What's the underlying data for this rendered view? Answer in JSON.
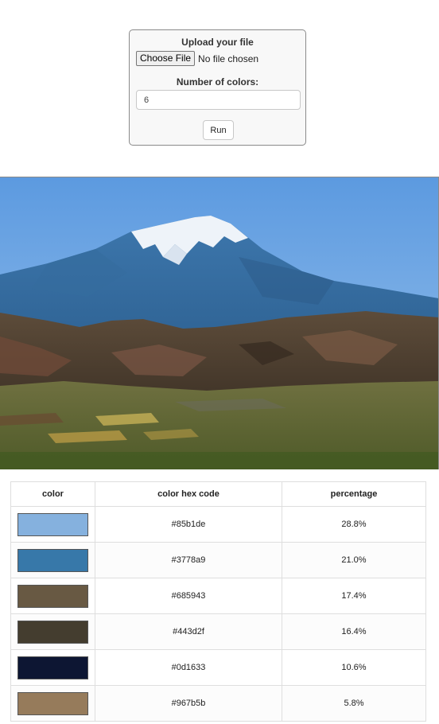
{
  "upload": {
    "title": "Upload your file",
    "choose_label": "Choose File",
    "file_status": "No file chosen",
    "colors_label": "Number of colors:",
    "colors_value": "6",
    "run_label": "Run"
  },
  "results": {
    "headers": [
      "color",
      "color hex code",
      "percentage"
    ],
    "rows": [
      {
        "color": "#85b1de",
        "hex": "#85b1de",
        "percentage": "28.8%"
      },
      {
        "color": "#3778a9",
        "hex": "#3778a9",
        "percentage": "21.0%"
      },
      {
        "color": "#685943",
        "hex": "#685943",
        "percentage": "17.4%"
      },
      {
        "color": "#443d2f",
        "hex": "#443d2f",
        "percentage": "16.4%"
      },
      {
        "color": "#0d1633",
        "hex": "#0d1633",
        "percentage": "10.6%"
      },
      {
        "color": "#967b5b",
        "hex": "#967b5b",
        "percentage": "5.8%"
      }
    ]
  }
}
